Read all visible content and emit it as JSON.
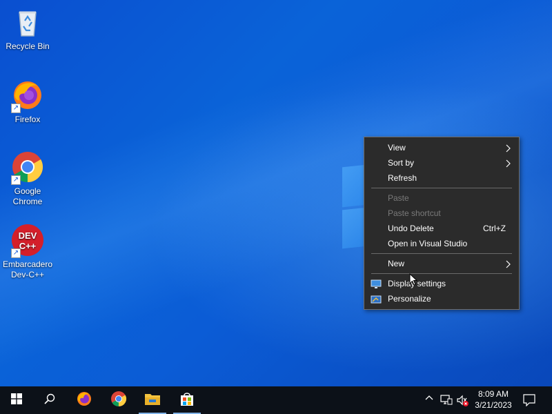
{
  "desktop": {
    "icons": [
      {
        "label": "Recycle Bin",
        "icon": "recycle-bin-icon"
      },
      {
        "label": "Firefox",
        "icon": "firefox-icon"
      },
      {
        "label": "Google Chrome",
        "icon": "chrome-icon"
      },
      {
        "label": "Embarcadero Dev-C++",
        "icon": "devcpp-icon"
      }
    ]
  },
  "context_menu": {
    "items": [
      {
        "label": "View",
        "has_submenu": true,
        "enabled": true
      },
      {
        "label": "Sort by",
        "has_submenu": true,
        "enabled": true
      },
      {
        "label": "Refresh",
        "enabled": true
      },
      {
        "label": "Paste",
        "enabled": false
      },
      {
        "label": "Paste shortcut",
        "enabled": false
      },
      {
        "label": "Undo Delete",
        "shortcut": "Ctrl+Z",
        "enabled": true
      },
      {
        "label": "Open in Visual Studio",
        "enabled": true
      },
      {
        "label": "New",
        "has_submenu": true,
        "enabled": true
      },
      {
        "label": "Display settings",
        "icon": "display-icon",
        "enabled": true
      },
      {
        "label": "Personalize",
        "icon": "personalize-icon",
        "enabled": true
      }
    ],
    "submenu_glyph": ">"
  },
  "taskbar": {
    "start_icon": "windows-icon",
    "search_icon": "search-icon",
    "pinned": [
      {
        "name": "Firefox",
        "icon": "firefox-icon",
        "active": false
      },
      {
        "name": "Google Chrome",
        "icon": "chrome-icon",
        "active": false
      },
      {
        "name": "File Explorer",
        "icon": "folder-icon",
        "active": true
      },
      {
        "name": "Microsoft Store",
        "icon": "store-icon",
        "active": true
      }
    ],
    "tray": {
      "chevron_glyph": "^",
      "time": "8:09 AM",
      "date": "3/21/2023"
    }
  },
  "colors": {
    "menu_bg": "#2b2b2b",
    "taskbar_bg": "#0c1118",
    "desktop_blue": "#0a5ad6"
  }
}
